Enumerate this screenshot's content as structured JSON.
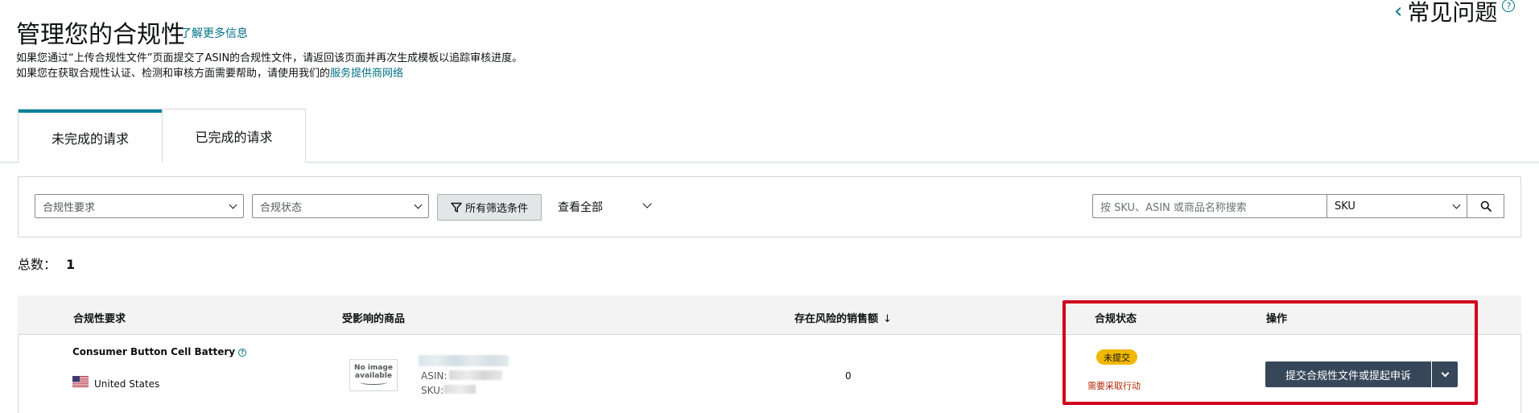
{
  "header": {
    "title": "管理您的合规性",
    "learn_more": "了解更多信息",
    "faq": "常见问题",
    "description_line1": "如果您通过“上传合规性文件”页面提交了ASIN的合规性文件，请返回该页面并再次生成模板以追踪审核进度。",
    "description_line2_prefix": "如果您在获取合规性认证、检测和审核方面需要帮助，请使用我们的",
    "description_line2_link": "服务提供商网络"
  },
  "tabs": [
    {
      "label": "未完成的请求",
      "active": true
    },
    {
      "label": "已完成的请求",
      "active": false
    }
  ],
  "filters": {
    "requirement_select": "合规性要求",
    "status_select": "合规状态",
    "all_filters_button": "所有筛选条件",
    "view_all": "查看全部",
    "search_placeholder": "按 SKU、ASIN 或商品名称搜索",
    "search_type": "SKU"
  },
  "summary": {
    "total_label": "总数：",
    "total_value": "1"
  },
  "table": {
    "headers": {
      "requirement": "合规性要求",
      "affected_products": "受影响的商品",
      "sales_at_risk": "存在风险的销售额",
      "sort_indicator": "↓",
      "status": "合规状态",
      "actions": "操作"
    },
    "rows": [
      {
        "requirement": "Consumer Button Cell Battery",
        "country": "United States",
        "no_image_text_1": "No image",
        "no_image_text_2": "available",
        "asin_label": "ASIN:",
        "sku_label": "SKU:",
        "sales_at_risk": "0",
        "status_badge": "未提交",
        "status_note": "需要采取行动",
        "action_button": "提交合规性文件或提起申诉"
      }
    ]
  },
  "colors": {
    "link": "#007185",
    "tab_accent": "#008296",
    "badge": "#f0b800",
    "action_needed": "#b12704",
    "primary_button": "#37475a",
    "highlight_box": "#d1001c"
  }
}
